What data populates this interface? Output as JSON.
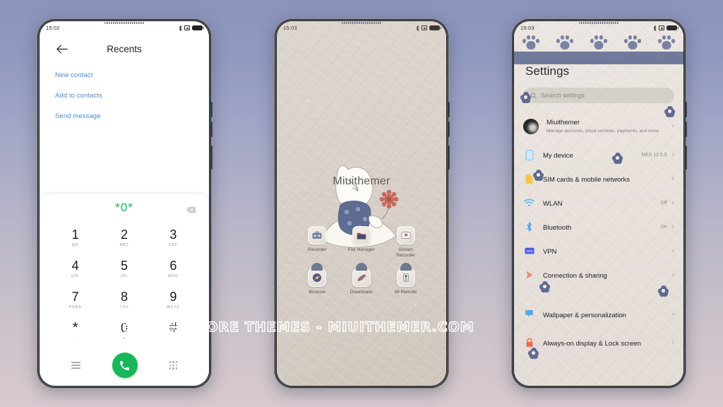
{
  "background": {
    "gradient_top": "#8a93bb",
    "gradient_bottom": "#d6cacf"
  },
  "watermark": {
    "text": "VISIT  FOR  MORE  THEMES  -  MIUITHEMER.COM"
  },
  "phone1": {
    "status": {
      "time": "15:02",
      "bluetooth_icon": "bluetooth-icon",
      "dnd_icon": "dnd-icon",
      "battery_icon": "battery-icon"
    },
    "appbar": {
      "back_icon": "back-arrow-icon",
      "title": "Recents"
    },
    "links": [
      {
        "label": "New contact"
      },
      {
        "label": "Add to contacts"
      },
      {
        "label": "Send message"
      }
    ],
    "dialer": {
      "number": "*0*",
      "backspace_icon": "backspace-icon",
      "accent_color": "#18b658",
      "link_color": "#4a8ad4",
      "keys": [
        {
          "digit": "1",
          "sub": "QD"
        },
        {
          "digit": "2",
          "sub": "ABC"
        },
        {
          "digit": "3",
          "sub": "DEF"
        },
        {
          "digit": "4",
          "sub": "GHI"
        },
        {
          "digit": "5",
          "sub": "JKL"
        },
        {
          "digit": "6",
          "sub": "MNO"
        },
        {
          "digit": "7",
          "sub": "PQRS"
        },
        {
          "digit": "8",
          "sub": "TUV"
        },
        {
          "digit": "9",
          "sub": "WXYZ"
        },
        {
          "digit": "*",
          "sub": ","
        },
        {
          "digit": "0",
          "sub": "+"
        },
        {
          "digit": "#",
          "sub": ""
        }
      ],
      "actions": {
        "menu_icon": "menu-lines-icon",
        "call_icon": "call-handset-icon",
        "keypad_icon": "keypad-dots-icon"
      }
    }
  },
  "phone2": {
    "status": {
      "time": "15:03",
      "bluetooth_icon": "bluetooth-icon",
      "dnd_icon": "dnd-icon",
      "battery_icon": "battery-icon"
    },
    "wallpaper": {
      "text": "Miuithemer",
      "illustration": "white-cat-with-flower"
    },
    "apps": [
      {
        "label": "Recorder",
        "icon": "recorder-icon"
      },
      {
        "label": "File Manager",
        "icon": "file-manager-icon"
      },
      {
        "label": "Screen Recorder",
        "icon": "screen-recorder-icon"
      },
      {
        "label": "Browser",
        "icon": "browser-icon"
      },
      {
        "label": "Downloads",
        "icon": "downloads-icon"
      },
      {
        "label": "Mi Remote",
        "icon": "mi-remote-icon"
      }
    ]
  },
  "phone3": {
    "status": {
      "time": "15:03",
      "bluetooth_icon": "bluetooth-icon",
      "dnd_icon": "dnd-icon",
      "battery_icon": "battery-icon"
    },
    "header": {
      "title": "Settings",
      "band_color": "#707b9c",
      "paw_color": "#7a83a4"
    },
    "search": {
      "placeholder": "Search settings",
      "icon": "search-icon"
    },
    "account": {
      "name": "Miuithemer",
      "subtitle": "Manage accounts, cloud services, payments, and more",
      "avatar": "account-avatar"
    },
    "items": [
      {
        "label": "My device",
        "value": "MIUI 12.5.5",
        "icon": "device-icon"
      },
      {
        "label": "SIM cards & mobile networks",
        "value": "",
        "icon": "sim-card-icon"
      },
      {
        "label": "WLAN",
        "value": "Off",
        "icon": "wifi-icon"
      },
      {
        "label": "Bluetooth",
        "value": "On",
        "icon": "bluetooth-icon"
      },
      {
        "label": "VPN",
        "value": "",
        "icon": "vpn-icon"
      },
      {
        "label": "Connection & sharing",
        "value": "",
        "icon": "connection-sharing-icon"
      },
      {
        "label": "Wallpaper & personalization",
        "value": "",
        "icon": "wallpaper-icon"
      },
      {
        "label": "Always-on display & Lock screen",
        "value": "",
        "icon": "lock-icon"
      }
    ]
  }
}
